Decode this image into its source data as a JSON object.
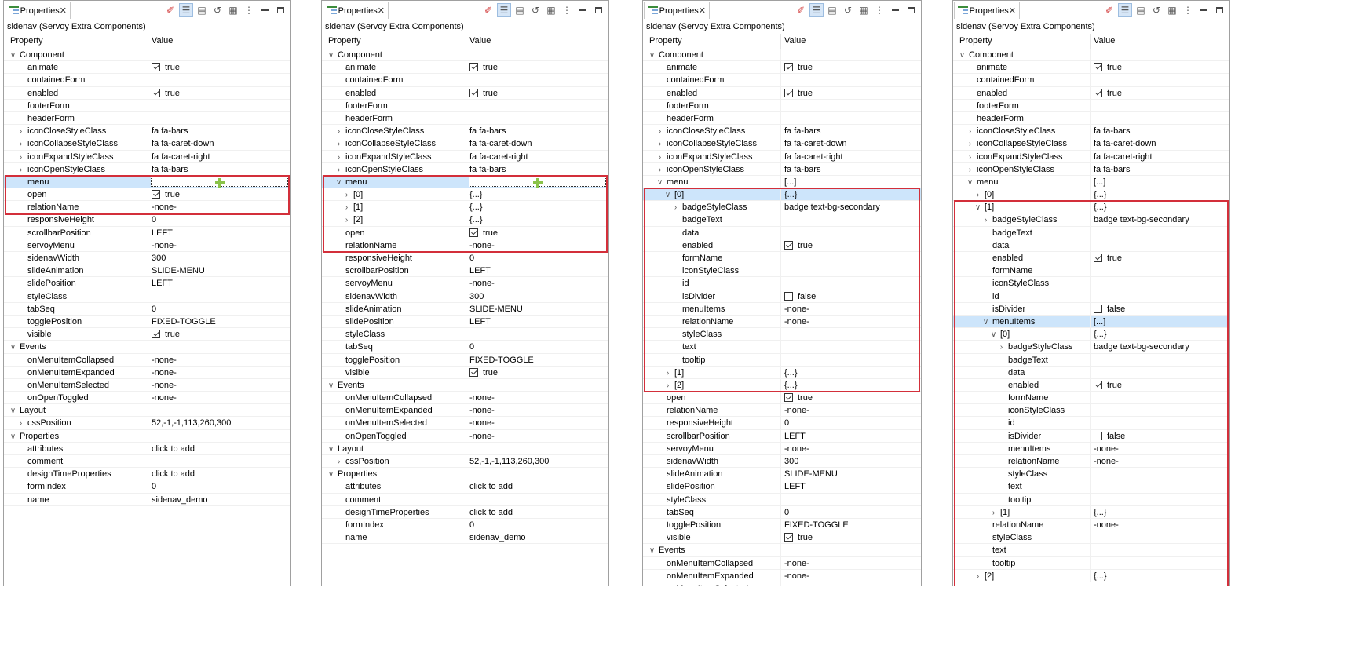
{
  "tab_title": "Properties",
  "subtitle": "sidenav (Servoy Extra Components)",
  "columns": {
    "property": "Property",
    "value": "Value"
  },
  "icons": [
    "properties-icon",
    "close-icon",
    "pin-icon",
    "categories-icon",
    "advanced-icon",
    "restore-default-icon",
    "columns-icon",
    "view-menu-icon",
    "minimize-icon",
    "maximize-icon"
  ],
  "colors": {
    "selection": "#cde5fb",
    "highlight_border": "#d32f3a",
    "add_icon": "#8bc34a"
  },
  "panels": [
    {
      "rows": [
        {
          "l": 0,
          "e": "v",
          "n": "Component"
        },
        {
          "l": 1,
          "n": "animate",
          "v": "true",
          "cb": true
        },
        {
          "l": 1,
          "n": "containedForm"
        },
        {
          "l": 1,
          "n": "enabled",
          "v": "true",
          "cb": true
        },
        {
          "l": 1,
          "n": "footerForm"
        },
        {
          "l": 1,
          "n": "headerForm"
        },
        {
          "l": 1,
          "e": ">",
          "n": "iconCloseStyleClass",
          "v": "fa fa-bars"
        },
        {
          "l": 1,
          "e": ">",
          "n": "iconCollapseStyleClass",
          "v": "fa fa-caret-down"
        },
        {
          "l": 1,
          "e": ">",
          "n": "iconExpandStyleClass",
          "v": "fa fa-caret-right"
        },
        {
          "l": 1,
          "e": ">",
          "n": "iconOpenStyleClass",
          "v": "fa fa-bars"
        },
        {
          "l": 1,
          "n": "menu",
          "edit": true,
          "sel": true
        },
        {
          "l": 1,
          "n": "open",
          "v": "true",
          "cb": true
        },
        {
          "l": 1,
          "n": "relationName",
          "v": "-none-"
        },
        {
          "l": 1,
          "n": "responsiveHeight",
          "v": "0"
        },
        {
          "l": 1,
          "n": "scrollbarPosition",
          "v": "LEFT"
        },
        {
          "l": 1,
          "n": "servoyMenu",
          "v": "-none-"
        },
        {
          "l": 1,
          "n": "sidenavWidth",
          "v": "300"
        },
        {
          "l": 1,
          "n": "slideAnimation",
          "v": "SLIDE-MENU"
        },
        {
          "l": 1,
          "n": "slidePosition",
          "v": "LEFT"
        },
        {
          "l": 1,
          "n": "styleClass"
        },
        {
          "l": 1,
          "n": "tabSeq",
          "v": "0"
        },
        {
          "l": 1,
          "n": "togglePosition",
          "v": "FIXED-TOGGLE"
        },
        {
          "l": 1,
          "n": "visible",
          "v": "true",
          "cb": true
        },
        {
          "l": 0,
          "e": "v",
          "n": "Events"
        },
        {
          "l": 1,
          "n": "onMenuItemCollapsed",
          "v": "-none-"
        },
        {
          "l": 1,
          "n": "onMenuItemExpanded",
          "v": "-none-"
        },
        {
          "l": 1,
          "n": "onMenuItemSelected",
          "v": "-none-"
        },
        {
          "l": 1,
          "n": "onOpenToggled",
          "v": "-none-"
        },
        {
          "l": 0,
          "e": "v",
          "n": "Layout"
        },
        {
          "l": 1,
          "e": ">",
          "n": "cssPosition",
          "v": "52,-1,-1,113,260,300"
        },
        {
          "l": 0,
          "e": "v",
          "n": "Properties"
        },
        {
          "l": 1,
          "n": "attributes",
          "v": "click to add"
        },
        {
          "l": 1,
          "n": "comment"
        },
        {
          "l": 1,
          "n": "designTimeProperties",
          "v": "click to add"
        },
        {
          "l": 1,
          "n": "formIndex",
          "v": "0"
        },
        {
          "l": 1,
          "n": "name",
          "v": "sidenav_demo"
        }
      ]
    },
    {
      "rows": [
        {
          "l": 0,
          "e": "v",
          "n": "Component"
        },
        {
          "l": 1,
          "n": "animate",
          "v": "true",
          "cb": true
        },
        {
          "l": 1,
          "n": "containedForm"
        },
        {
          "l": 1,
          "n": "enabled",
          "v": "true",
          "cb": true
        },
        {
          "l": 1,
          "n": "footerForm"
        },
        {
          "l": 1,
          "n": "headerForm"
        },
        {
          "l": 1,
          "e": ">",
          "n": "iconCloseStyleClass",
          "v": "fa fa-bars"
        },
        {
          "l": 1,
          "e": ">",
          "n": "iconCollapseStyleClass",
          "v": "fa fa-caret-down"
        },
        {
          "l": 1,
          "e": ">",
          "n": "iconExpandStyleClass",
          "v": "fa fa-caret-right"
        },
        {
          "l": 1,
          "e": ">",
          "n": "iconOpenStyleClass",
          "v": "fa fa-bars"
        },
        {
          "l": 1,
          "e": "v",
          "n": "menu",
          "edit": true,
          "sel": true
        },
        {
          "l": 2,
          "e": ">",
          "n": "[0]",
          "v": "{...}"
        },
        {
          "l": 2,
          "e": ">",
          "n": "[1]",
          "v": "{...}"
        },
        {
          "l": 2,
          "e": ">",
          "n": "[2]",
          "v": "{...}"
        },
        {
          "l": 1,
          "n": "open",
          "v": "true",
          "cb": true
        },
        {
          "l": 1,
          "n": "relationName",
          "v": "-none-"
        },
        {
          "l": 1,
          "n": "responsiveHeight",
          "v": "0"
        },
        {
          "l": 1,
          "n": "scrollbarPosition",
          "v": "LEFT"
        },
        {
          "l": 1,
          "n": "servoyMenu",
          "v": "-none-"
        },
        {
          "l": 1,
          "n": "sidenavWidth",
          "v": "300"
        },
        {
          "l": 1,
          "n": "slideAnimation",
          "v": "SLIDE-MENU"
        },
        {
          "l": 1,
          "n": "slidePosition",
          "v": "LEFT"
        },
        {
          "l": 1,
          "n": "styleClass"
        },
        {
          "l": 1,
          "n": "tabSeq",
          "v": "0"
        },
        {
          "l": 1,
          "n": "togglePosition",
          "v": "FIXED-TOGGLE"
        },
        {
          "l": 1,
          "n": "visible",
          "v": "true",
          "cb": true
        },
        {
          "l": 0,
          "e": "v",
          "n": "Events"
        },
        {
          "l": 1,
          "n": "onMenuItemCollapsed",
          "v": "-none-"
        },
        {
          "l": 1,
          "n": "onMenuItemExpanded",
          "v": "-none-"
        },
        {
          "l": 1,
          "n": "onMenuItemSelected",
          "v": "-none-"
        },
        {
          "l": 1,
          "n": "onOpenToggled",
          "v": "-none-"
        },
        {
          "l": 0,
          "e": "v",
          "n": "Layout"
        },
        {
          "l": 1,
          "e": ">",
          "n": "cssPosition",
          "v": "52,-1,-1,113,260,300"
        },
        {
          "l": 0,
          "e": "v",
          "n": "Properties"
        },
        {
          "l": 1,
          "n": "attributes",
          "v": "click to add"
        },
        {
          "l": 1,
          "n": "comment"
        },
        {
          "l": 1,
          "n": "designTimeProperties",
          "v": "click to add"
        },
        {
          "l": 1,
          "n": "formIndex",
          "v": "0"
        },
        {
          "l": 1,
          "n": "name",
          "v": "sidenav_demo"
        }
      ]
    },
    {
      "rows": [
        {
          "l": 0,
          "e": "v",
          "n": "Component"
        },
        {
          "l": 1,
          "n": "animate",
          "v": "true",
          "cb": true
        },
        {
          "l": 1,
          "n": "containedForm"
        },
        {
          "l": 1,
          "n": "enabled",
          "v": "true",
          "cb": true
        },
        {
          "l": 1,
          "n": "footerForm"
        },
        {
          "l": 1,
          "n": "headerForm"
        },
        {
          "l": 1,
          "e": ">",
          "n": "iconCloseStyleClass",
          "v": "fa fa-bars"
        },
        {
          "l": 1,
          "e": ">",
          "n": "iconCollapseStyleClass",
          "v": "fa fa-caret-down"
        },
        {
          "l": 1,
          "e": ">",
          "n": "iconExpandStyleClass",
          "v": "fa fa-caret-right"
        },
        {
          "l": 1,
          "e": ">",
          "n": "iconOpenStyleClass",
          "v": "fa fa-bars"
        },
        {
          "l": 1,
          "e": "v",
          "n": "menu",
          "v": "[...]"
        },
        {
          "l": 2,
          "e": "v",
          "n": "[0]",
          "v": "{...}",
          "sel": true
        },
        {
          "l": 3,
          "e": ">",
          "n": "badgeStyleClass",
          "v": "badge text-bg-secondary"
        },
        {
          "l": 3,
          "n": "badgeText"
        },
        {
          "l": 3,
          "n": "data"
        },
        {
          "l": 3,
          "n": "enabled",
          "v": "true",
          "cb": true
        },
        {
          "l": 3,
          "n": "formName"
        },
        {
          "l": 3,
          "n": "iconStyleClass"
        },
        {
          "l": 3,
          "n": "id"
        },
        {
          "l": 3,
          "n": "isDivider",
          "v": "false",
          "cb": false
        },
        {
          "l": 3,
          "n": "menuItems",
          "v": "-none-"
        },
        {
          "l": 3,
          "n": "relationName",
          "v": "-none-"
        },
        {
          "l": 3,
          "n": "styleClass"
        },
        {
          "l": 3,
          "n": "text"
        },
        {
          "l": 3,
          "n": "tooltip"
        },
        {
          "l": 2,
          "e": ">",
          "n": "[1]",
          "v": "{...}"
        },
        {
          "l": 2,
          "e": ">",
          "n": "[2]",
          "v": "{...}"
        },
        {
          "l": 1,
          "n": "open",
          "v": "true",
          "cb": true
        },
        {
          "l": 1,
          "n": "relationName",
          "v": "-none-"
        },
        {
          "l": 1,
          "n": "responsiveHeight",
          "v": "0"
        },
        {
          "l": 1,
          "n": "scrollbarPosition",
          "v": "LEFT"
        },
        {
          "l": 1,
          "n": "servoyMenu",
          "v": "-none-"
        },
        {
          "l": 1,
          "n": "sidenavWidth",
          "v": "300"
        },
        {
          "l": 1,
          "n": "slideAnimation",
          "v": "SLIDE-MENU"
        },
        {
          "l": 1,
          "n": "slidePosition",
          "v": "LEFT"
        },
        {
          "l": 1,
          "n": "styleClass"
        },
        {
          "l": 1,
          "n": "tabSeq",
          "v": "0"
        },
        {
          "l": 1,
          "n": "togglePosition",
          "v": "FIXED-TOGGLE"
        },
        {
          "l": 1,
          "n": "visible",
          "v": "true",
          "cb": true
        },
        {
          "l": 0,
          "e": "v",
          "n": "Events"
        },
        {
          "l": 1,
          "n": "onMenuItemCollapsed",
          "v": "-none-"
        },
        {
          "l": 1,
          "n": "onMenuItemExpanded",
          "v": "-none-"
        },
        {
          "l": 1,
          "n": "onMenuItemSelected",
          "v": "-none-"
        }
      ]
    },
    {
      "rows": [
        {
          "l": 0,
          "e": "v",
          "n": "Component"
        },
        {
          "l": 1,
          "n": "animate",
          "v": "true",
          "cb": true
        },
        {
          "l": 1,
          "n": "containedForm"
        },
        {
          "l": 1,
          "n": "enabled",
          "v": "true",
          "cb": true
        },
        {
          "l": 1,
          "n": "footerForm"
        },
        {
          "l": 1,
          "n": "headerForm"
        },
        {
          "l": 1,
          "e": ">",
          "n": "iconCloseStyleClass",
          "v": "fa fa-bars"
        },
        {
          "l": 1,
          "e": ">",
          "n": "iconCollapseStyleClass",
          "v": "fa fa-caret-down"
        },
        {
          "l": 1,
          "e": ">",
          "n": "iconExpandStyleClass",
          "v": "fa fa-caret-right"
        },
        {
          "l": 1,
          "e": ">",
          "n": "iconOpenStyleClass",
          "v": "fa fa-bars"
        },
        {
          "l": 1,
          "e": "v",
          "n": "menu",
          "v": "[...]"
        },
        {
          "l": 2,
          "e": ">",
          "n": "[0]",
          "v": "{...}"
        },
        {
          "l": 2,
          "e": "v",
          "n": "[1]",
          "v": "{...}"
        },
        {
          "l": 3,
          "e": ">",
          "n": "badgeStyleClass",
          "v": "badge text-bg-secondary"
        },
        {
          "l": 3,
          "n": "badgeText"
        },
        {
          "l": 3,
          "n": "data"
        },
        {
          "l": 3,
          "n": "enabled",
          "v": "true",
          "cb": true
        },
        {
          "l": 3,
          "n": "formName"
        },
        {
          "l": 3,
          "n": "iconStyleClass"
        },
        {
          "l": 3,
          "n": "id"
        },
        {
          "l": 3,
          "n": "isDivider",
          "v": "false",
          "cb": false
        },
        {
          "l": 3,
          "e": "v",
          "n": "menuItems",
          "v": "[...]",
          "sel": true
        },
        {
          "l": 4,
          "e": "v",
          "n": "[0]",
          "v": "{...}"
        },
        {
          "l": 5,
          "e": ">",
          "n": "badgeStyleClass",
          "v": "badge text-bg-secondary"
        },
        {
          "l": 5,
          "n": "badgeText"
        },
        {
          "l": 5,
          "n": "data"
        },
        {
          "l": 5,
          "n": "enabled",
          "v": "true",
          "cb": true
        },
        {
          "l": 5,
          "n": "formName"
        },
        {
          "l": 5,
          "n": "iconStyleClass"
        },
        {
          "l": 5,
          "n": "id"
        },
        {
          "l": 5,
          "n": "isDivider",
          "v": "false",
          "cb": false
        },
        {
          "l": 5,
          "n": "menuItems",
          "v": "-none-"
        },
        {
          "l": 5,
          "n": "relationName",
          "v": "-none-"
        },
        {
          "l": 5,
          "n": "styleClass"
        },
        {
          "l": 5,
          "n": "text"
        },
        {
          "l": 5,
          "n": "tooltip"
        },
        {
          "l": 4,
          "e": ">",
          "n": "[1]",
          "v": "{...}"
        },
        {
          "l": 3,
          "n": "relationName",
          "v": "-none-"
        },
        {
          "l": 3,
          "n": "styleClass"
        },
        {
          "l": 3,
          "n": "text"
        },
        {
          "l": 3,
          "n": "tooltip"
        },
        {
          "l": 2,
          "e": ">",
          "n": "[2]",
          "v": "{...}"
        }
      ]
    }
  ]
}
